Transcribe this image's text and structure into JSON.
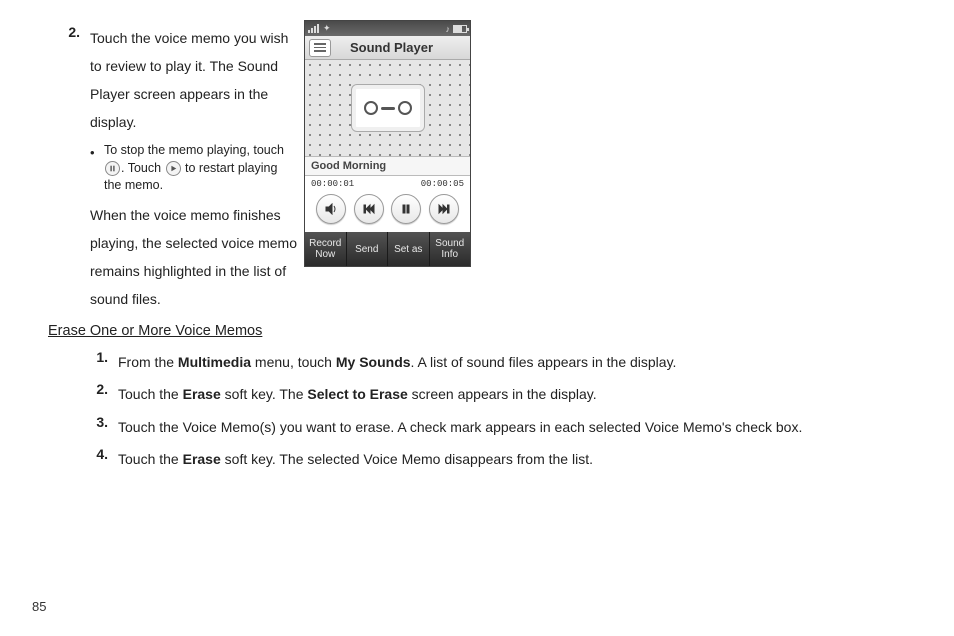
{
  "step2": {
    "num": "2.",
    "text": "Touch the voice memo you wish to review to play it. The Sound Player screen appears in the display.",
    "bullet_pre": "To stop the memo playing, touch ",
    "bullet_mid": ". Touch ",
    "bullet_post": " to restart playing the memo.",
    "after": "When the voice memo finishes playing, the selected voice memo remains highlighted in the list of sound files."
  },
  "subheading": "Erase One or More Voice Memos",
  "erase_steps": [
    {
      "num": "1.",
      "pre": "From the ",
      "b1": "Multimedia",
      "mid1": " menu, touch ",
      "b2": "My Sounds",
      "post": ". A list of sound files appears in the display."
    },
    {
      "num": "2.",
      "pre": "Touch the ",
      "b1": "Erase",
      "mid1": " soft key. The ",
      "b2": "Select to Erase",
      "post": " screen appears in the display."
    },
    {
      "num": "3.",
      "pre": "Touch the Voice Memo(s) you want to erase. A check mark appears in each selected Voice Memo's check box.",
      "b1": "",
      "mid1": "",
      "b2": "",
      "post": ""
    },
    {
      "num": "4.",
      "pre": "Touch the ",
      "b1": "Erase",
      "mid1": " soft key. The selected Voice Memo disappears from the list.",
      "b2": "",
      "post": ""
    }
  ],
  "phone": {
    "title": "Sound Player",
    "track": "Good Morning",
    "time_elapsed": "00:00:01",
    "time_total": "00:00:05",
    "softkeys": [
      "Record Now",
      "Send",
      "Set as",
      "Sound Info"
    ]
  },
  "page_number": "85"
}
